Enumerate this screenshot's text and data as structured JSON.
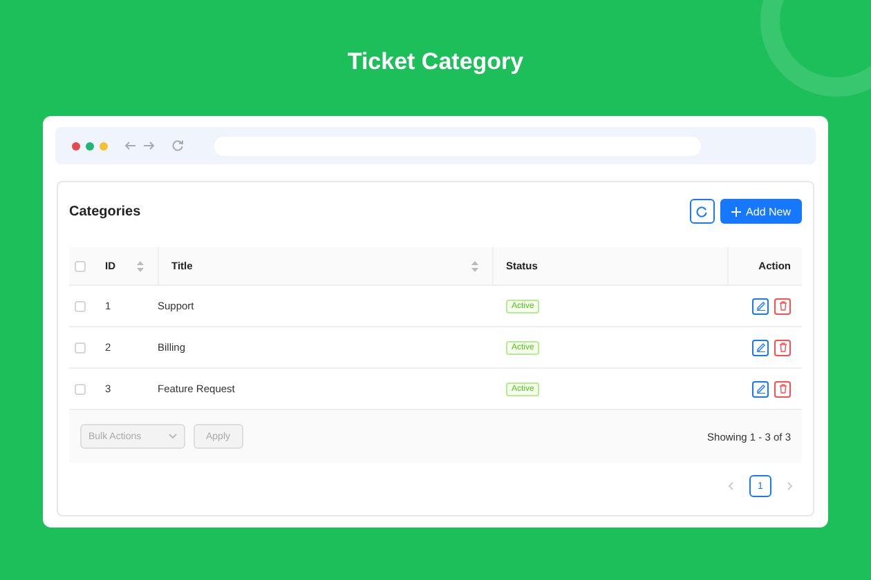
{
  "page_title": "Ticket Category",
  "card": {
    "title": "Categories",
    "add_button": "Add New"
  },
  "table": {
    "header_checked": false,
    "columns": [
      {
        "label": "ID",
        "sortable": true
      },
      {
        "label": "Title",
        "sortable": true
      },
      {
        "label": "Status",
        "sortable": false
      },
      {
        "label": "Action",
        "sortable": false
      }
    ],
    "rows": [
      {
        "checked": false,
        "id": "1",
        "title": "Support",
        "status": "Active"
      },
      {
        "checked": false,
        "id": "2",
        "title": "Billing",
        "status": "Active"
      },
      {
        "checked": false,
        "id": "3",
        "title": "Feature Request",
        "status": "Active"
      }
    ]
  },
  "footer": {
    "bulk_actions": {
      "placeholder": "Bulk Actions",
      "disabled": true
    },
    "apply": {
      "label": "Apply",
      "disabled": true
    },
    "showing": "Showing 1 - 3 of 3"
  },
  "pagination": {
    "pages": [
      {
        "label": "1",
        "selected": true
      }
    ]
  }
}
